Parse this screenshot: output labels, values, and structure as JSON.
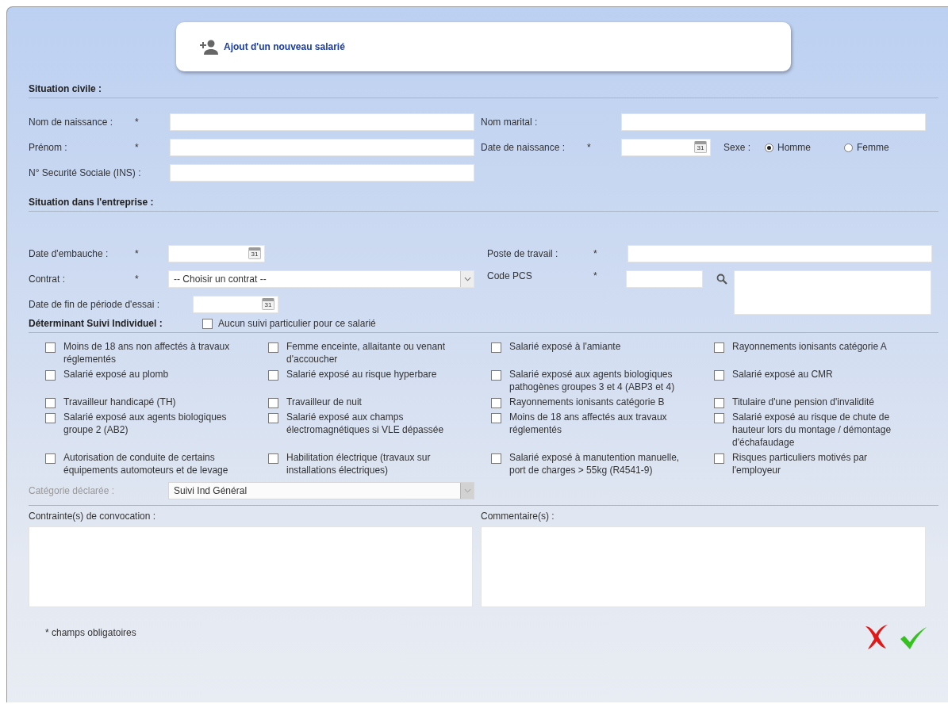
{
  "header": {
    "title": "Ajout d'un nouveau salarié"
  },
  "civil": {
    "title": "Situation civile :",
    "birth_name": {
      "label": "Nom de naissance :",
      "mark": "*"
    },
    "marital_name": {
      "label": "Nom marital :"
    },
    "first_name": {
      "label": "Prénom :",
      "mark": "*"
    },
    "birth_date": {
      "label": "Date de naissance :",
      "mark": "*",
      "calendar": "31"
    },
    "sex": {
      "label": "Sexe :",
      "options": [
        {
          "label": "Homme",
          "selected": true
        },
        {
          "label": "Femme",
          "selected": false
        }
      ]
    },
    "ssn": {
      "label": "N° Securité Sociale (INS) :"
    }
  },
  "company": {
    "title": "Situation dans l'entreprise :",
    "hire_date": {
      "label": "Date d'embauche :",
      "mark": "*",
      "calendar": "31"
    },
    "contract": {
      "label": "Contrat :",
      "mark": "*",
      "value": "-- Choisir un contrat --"
    },
    "trial_end": {
      "label": "Date de fin de période d'essai :",
      "calendar": "31"
    },
    "job": {
      "label": "Poste de travail :",
      "mark": "*"
    },
    "pcs_code": {
      "label": "Code PCS",
      "mark": "*"
    }
  },
  "followup": {
    "label": "Déterminant Suivi Individuel :",
    "none": {
      "label": "Aucun suivi particulier pour ce salarié",
      "checked": false
    },
    "items": [
      {
        "label": "Moins de 18 ans non affectés à travaux réglementés",
        "checked": false
      },
      {
        "label": "Femme enceinte, allaitante ou venant d'accoucher",
        "checked": false
      },
      {
        "label": "Salarié exposé à l'amiante",
        "checked": false
      },
      {
        "label": "Rayonnements ionisants catégorie A",
        "checked": false
      },
      {
        "label": "Salarié exposé au plomb",
        "checked": false
      },
      {
        "label": "Salarié exposé au risque hyperbare",
        "checked": false
      },
      {
        "label": "Salarié exposé aux agents biologiques pathogènes groupes 3 et 4 (ABP3 et 4)",
        "checked": false
      },
      {
        "label": "Salarié exposé au CMR",
        "checked": false
      },
      {
        "label": "Travailleur handicapé (TH)",
        "checked": false
      },
      {
        "label": "Travailleur de nuit",
        "checked": false
      },
      {
        "label": "Rayonnements ionisants catégorie B",
        "checked": false
      },
      {
        "label": "Titulaire d'une pension d'invalidité",
        "checked": false
      },
      {
        "label": "Salarié exposé aux agents biologiques groupe 2 (AB2)",
        "checked": false
      },
      {
        "label": "Salarié exposé aux champs électromagnétiques si VLE dépassée",
        "checked": false
      },
      {
        "label": "Moins de 18 ans affectés aux travaux réglementés",
        "checked": false
      },
      {
        "label": "Salarié exposé au risque de chute de hauteur lors du montage / démontage d'échafaudage",
        "checked": false
      },
      {
        "label": "Autorisation de conduite de certains équipements automoteurs et de levage",
        "checked": false
      },
      {
        "label": "Habilitation électrique (travaux sur installations électriques)",
        "checked": false
      },
      {
        "label": "Salarié exposé à manutention manuelle, port de charges > 55kg (R4541-9)",
        "checked": false
      },
      {
        "label": "Risques particuliers motivés par l'employeur",
        "checked": false
      }
    ]
  },
  "category": {
    "label": "Catégorie déclarée :",
    "value": "Suivi Ind Général",
    "disabled": true
  },
  "constraints": {
    "label": "Contrainte(s) de convocation :"
  },
  "comments": {
    "label": "Commentaire(s) :"
  },
  "footnote": "* champs obligatoires"
}
